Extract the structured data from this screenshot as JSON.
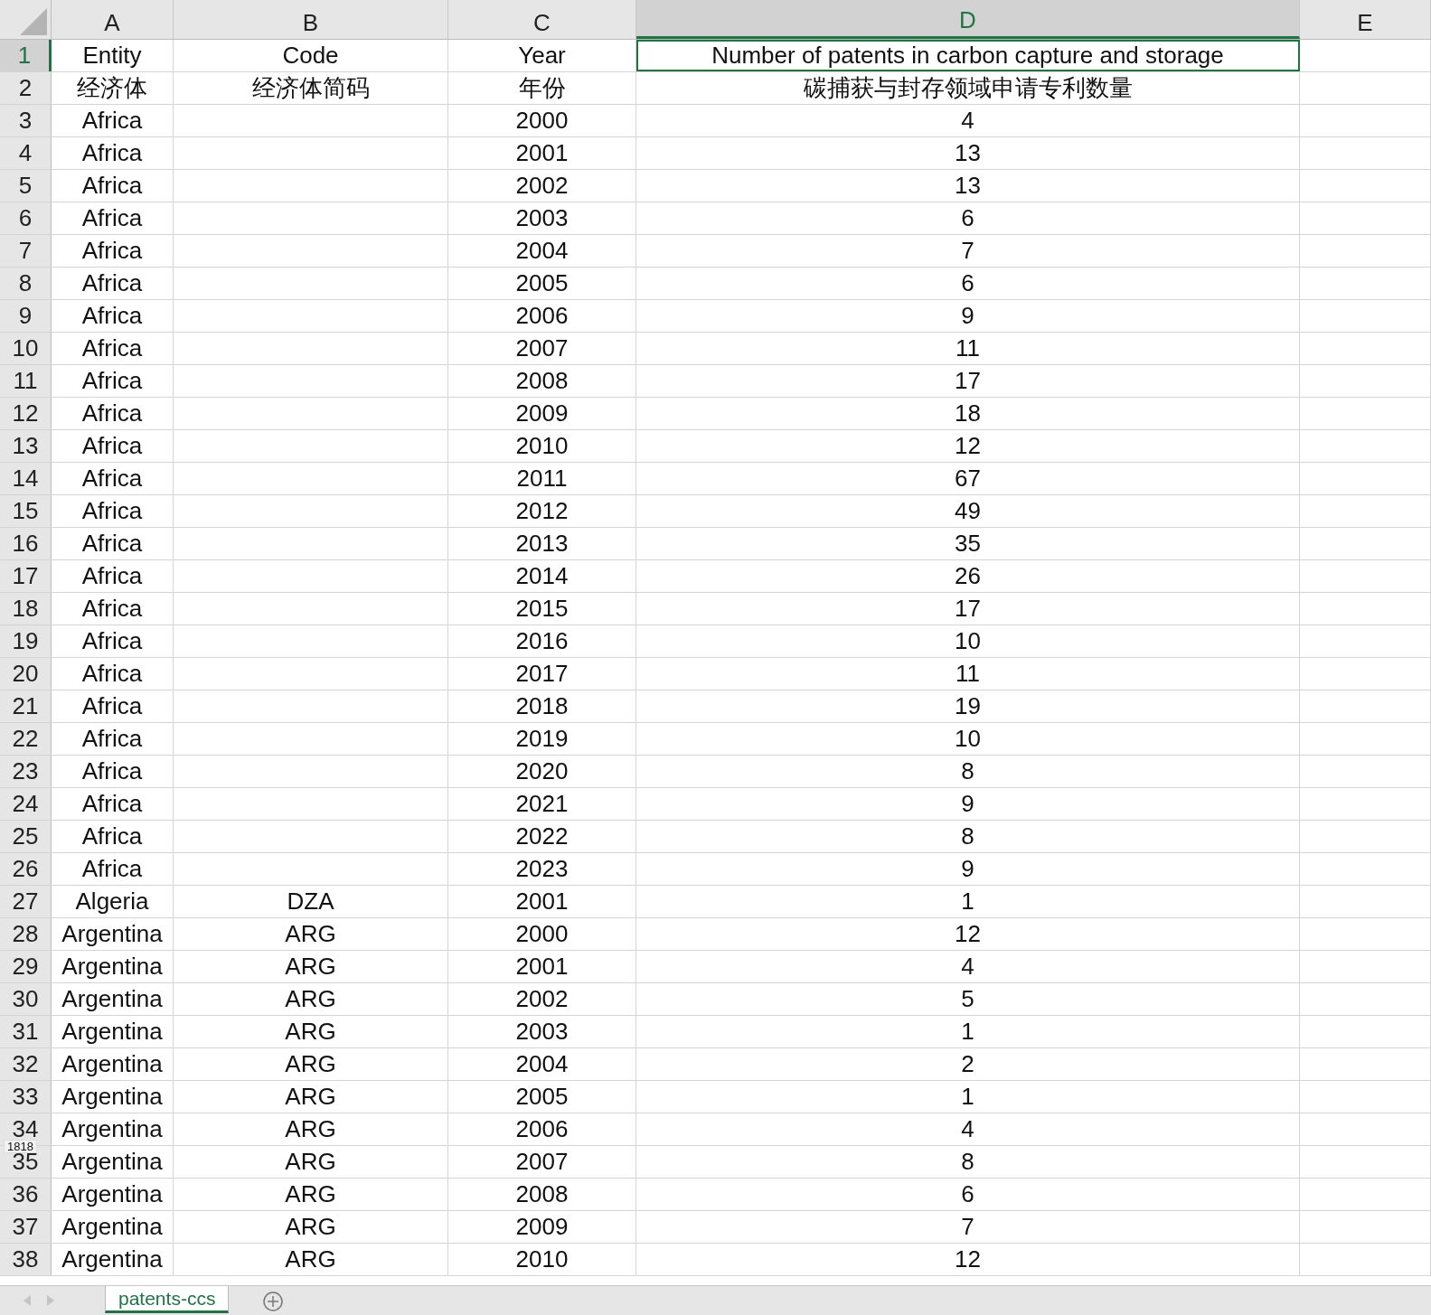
{
  "columns": [
    {
      "label": "A",
      "selected": false
    },
    {
      "label": "B",
      "selected": false
    },
    {
      "label": "C",
      "selected": false
    },
    {
      "label": "D",
      "selected": true
    },
    {
      "label": "E",
      "selected": false
    }
  ],
  "rows": [
    {
      "number": "1",
      "selected": true,
      "cells": [
        "Entity",
        "Code",
        "Year",
        "Number of patents in carbon capture and storage",
        ""
      ]
    },
    {
      "number": "2",
      "selected": false,
      "cells": [
        "经济体",
        "经济体简码",
        "年份",
        "碳捕获与封存领域申请专利数量",
        ""
      ]
    },
    {
      "number": "3",
      "selected": false,
      "cells": [
        "Africa",
        "",
        "2000",
        "4",
        ""
      ]
    },
    {
      "number": "4",
      "selected": false,
      "cells": [
        "Africa",
        "",
        "2001",
        "13",
        ""
      ]
    },
    {
      "number": "5",
      "selected": false,
      "cells": [
        "Africa",
        "",
        "2002",
        "13",
        ""
      ]
    },
    {
      "number": "6",
      "selected": false,
      "cells": [
        "Africa",
        "",
        "2003",
        "6",
        ""
      ]
    },
    {
      "number": "7",
      "selected": false,
      "cells": [
        "Africa",
        "",
        "2004",
        "7",
        ""
      ]
    },
    {
      "number": "8",
      "selected": false,
      "cells": [
        "Africa",
        "",
        "2005",
        "6",
        ""
      ]
    },
    {
      "number": "9",
      "selected": false,
      "cells": [
        "Africa",
        "",
        "2006",
        "9",
        ""
      ]
    },
    {
      "number": "10",
      "selected": false,
      "cells": [
        "Africa",
        "",
        "2007",
        "11",
        ""
      ]
    },
    {
      "number": "11",
      "selected": false,
      "cells": [
        "Africa",
        "",
        "2008",
        "17",
        ""
      ]
    },
    {
      "number": "12",
      "selected": false,
      "cells": [
        "Africa",
        "",
        "2009",
        "18",
        ""
      ]
    },
    {
      "number": "13",
      "selected": false,
      "cells": [
        "Africa",
        "",
        "2010",
        "12",
        ""
      ]
    },
    {
      "number": "14",
      "selected": false,
      "cells": [
        "Africa",
        "",
        "2011",
        "67",
        ""
      ]
    },
    {
      "number": "15",
      "selected": false,
      "cells": [
        "Africa",
        "",
        "2012",
        "49",
        ""
      ]
    },
    {
      "number": "16",
      "selected": false,
      "cells": [
        "Africa",
        "",
        "2013",
        "35",
        ""
      ]
    },
    {
      "number": "17",
      "selected": false,
      "cells": [
        "Africa",
        "",
        "2014",
        "26",
        ""
      ]
    },
    {
      "number": "18",
      "selected": false,
      "cells": [
        "Africa",
        "",
        "2015",
        "17",
        ""
      ]
    },
    {
      "number": "19",
      "selected": false,
      "cells": [
        "Africa",
        "",
        "2016",
        "10",
        ""
      ]
    },
    {
      "number": "20",
      "selected": false,
      "cells": [
        "Africa",
        "",
        "2017",
        "11",
        ""
      ]
    },
    {
      "number": "21",
      "selected": false,
      "cells": [
        "Africa",
        "",
        "2018",
        "19",
        ""
      ]
    },
    {
      "number": "22",
      "selected": false,
      "cells": [
        "Africa",
        "",
        "2019",
        "10",
        ""
      ]
    },
    {
      "number": "23",
      "selected": false,
      "cells": [
        "Africa",
        "",
        "2020",
        "8",
        ""
      ]
    },
    {
      "number": "24",
      "selected": false,
      "cells": [
        "Africa",
        "",
        "2021",
        "9",
        ""
      ]
    },
    {
      "number": "25",
      "selected": false,
      "cells": [
        "Africa",
        "",
        "2022",
        "8",
        ""
      ]
    },
    {
      "number": "26",
      "selected": false,
      "cells": [
        "Africa",
        "",
        "2023",
        "9",
        ""
      ]
    },
    {
      "number": "27",
      "selected": false,
      "cells": [
        "Algeria",
        "DZA",
        "2001",
        "1",
        ""
      ]
    },
    {
      "number": "28",
      "selected": false,
      "cells": [
        "Argentina",
        "ARG",
        "2000",
        "12",
        ""
      ]
    },
    {
      "number": "29",
      "selected": false,
      "cells": [
        "Argentina",
        "ARG",
        "2001",
        "4",
        ""
      ]
    },
    {
      "number": "30",
      "selected": false,
      "cells": [
        "Argentina",
        "ARG",
        "2002",
        "5",
        ""
      ]
    },
    {
      "number": "31",
      "selected": false,
      "cells": [
        "Argentina",
        "ARG",
        "2003",
        "1",
        ""
      ]
    },
    {
      "number": "32",
      "selected": false,
      "cells": [
        "Argentina",
        "ARG",
        "2004",
        "2",
        ""
      ]
    },
    {
      "number": "33",
      "selected": false,
      "cells": [
        "Argentina",
        "ARG",
        "2005",
        "1",
        ""
      ]
    },
    {
      "number": "34",
      "selected": false,
      "cells": [
        "Argentina",
        "ARG",
        "2006",
        "4",
        ""
      ]
    },
    {
      "number": "35",
      "selected": false,
      "cells": [
        "Argentina",
        "ARG",
        "2007",
        "8",
        ""
      ]
    },
    {
      "number": "36",
      "selected": false,
      "cells": [
        "Argentina",
        "ARG",
        "2008",
        "6",
        ""
      ]
    },
    {
      "number": "37",
      "selected": false,
      "cells": [
        "Argentina",
        "ARG",
        "2009",
        "7",
        ""
      ]
    },
    {
      "number": "38",
      "selected": false,
      "cells": [
        "Argentina",
        "ARG",
        "2010",
        "12",
        ""
      ]
    }
  ],
  "tooltip": "1818",
  "sheet_tabs": [
    {
      "label": "patents-ccs",
      "selected": true
    }
  ]
}
